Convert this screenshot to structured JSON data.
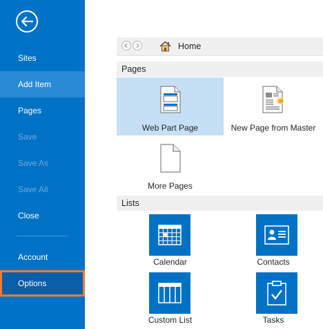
{
  "sidebar": {
    "back_label": "Back",
    "items": [
      {
        "label": "Sites",
        "state": "normal"
      },
      {
        "label": "Add Item",
        "state": "hover"
      },
      {
        "label": "Pages",
        "state": "normal"
      },
      {
        "label": "Save",
        "state": "disabled"
      },
      {
        "label": "Save As",
        "state": "disabled"
      },
      {
        "label": "Save All",
        "state": "disabled"
      },
      {
        "label": "Close",
        "state": "normal"
      },
      {
        "label": "Account",
        "state": "normal"
      },
      {
        "label": "Options",
        "state": "selected"
      }
    ]
  },
  "breadcrumb": {
    "label": "Home",
    "icon": "home-icon"
  },
  "pages_section": {
    "header": "Pages",
    "tiles": [
      {
        "label": "Web Part Page",
        "icon": "web-part-page-icon",
        "selected": true
      },
      {
        "label": "New Page from Master",
        "icon": "page-from-master-icon",
        "selected": false
      },
      {
        "label": "More Pages",
        "icon": "blank-page-icon",
        "selected": false
      }
    ]
  },
  "lists_section": {
    "header": "Lists",
    "tiles": [
      {
        "label": "Calendar",
        "icon": "calendar-icon"
      },
      {
        "label": "Contacts",
        "icon": "contacts-icon"
      },
      {
        "label": "Custom List",
        "icon": "custom-list-icon"
      },
      {
        "label": "Tasks",
        "icon": "tasks-icon"
      }
    ]
  },
  "colors": {
    "sidebar_bg": "#0072c6",
    "selected_outline": "#ed7d31",
    "tile_selected_bg": "#c5dff5",
    "list_icon_bg": "#0072c6"
  }
}
